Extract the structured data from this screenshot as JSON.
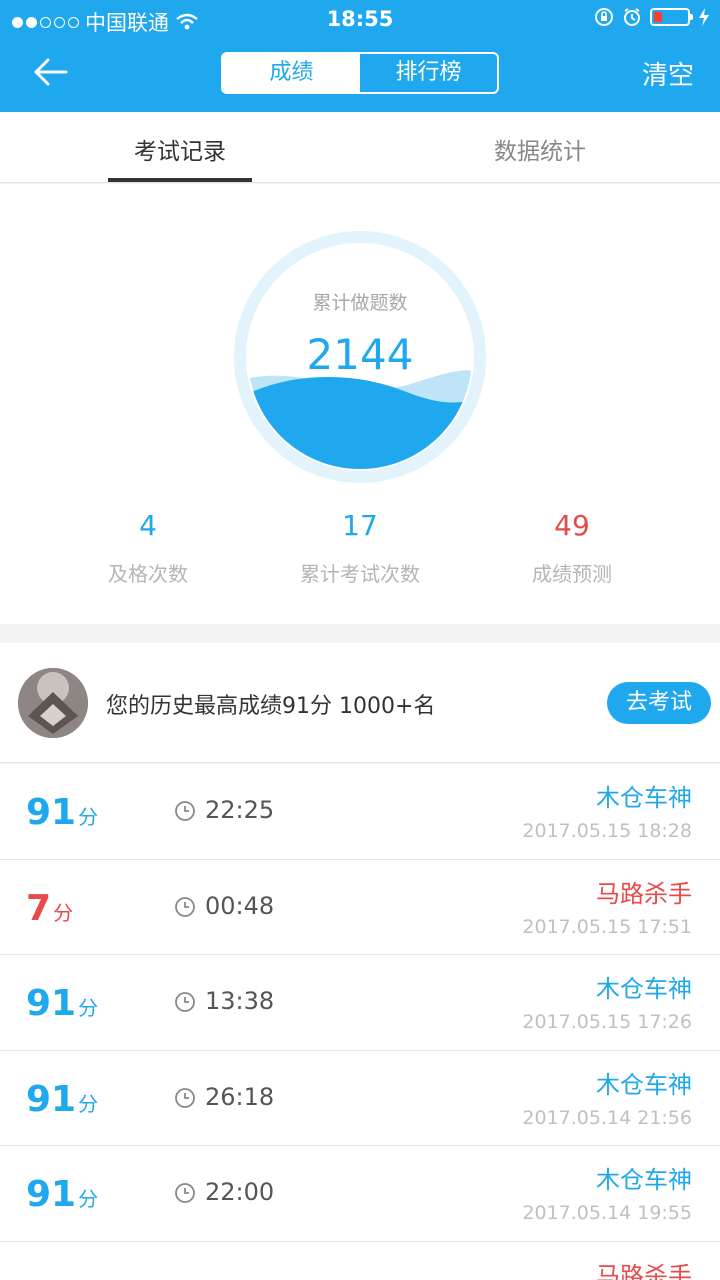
{
  "status_bar": {
    "carrier": "中国联通",
    "time": "18:55"
  },
  "header": {
    "segments": [
      "成绩",
      "排行榜"
    ],
    "active_segment": "成绩",
    "clear_label": "清空"
  },
  "tabs": [
    {
      "label": "考试记录",
      "active": true
    },
    {
      "label": "数据统计",
      "active": false
    }
  ],
  "summary": {
    "total_label": "累计做题数",
    "total_value": "2144",
    "stats": [
      {
        "value": "4",
        "label": "及格次数",
        "color": "#1fa8ee"
      },
      {
        "value": "17",
        "label": "累计考试次数",
        "color": "#1fa8ee"
      },
      {
        "value": "49",
        "label": "成绩预测",
        "color": "#e84a4a"
      }
    ]
  },
  "best": {
    "text": "您的历史最高成绩91分 1000+名",
    "button_label": "去考试"
  },
  "records": [
    {
      "score": "91",
      "unit": "分",
      "duration": "22:25",
      "title": "木仓车神",
      "date": "2017.05.15 18:28",
      "status": "pass"
    },
    {
      "score": "7",
      "unit": "分",
      "duration": "00:48",
      "title": "马路杀手",
      "date": "2017.05.15 17:51",
      "status": "fail"
    },
    {
      "score": "91",
      "unit": "分",
      "duration": "13:38",
      "title": "木仓车神",
      "date": "2017.05.15 17:26",
      "status": "pass"
    },
    {
      "score": "91",
      "unit": "分",
      "duration": "26:18",
      "title": "木仓车神",
      "date": "2017.05.14 21:56",
      "status": "pass"
    },
    {
      "score": "91",
      "unit": "分",
      "duration": "22:00",
      "title": "木仓车神",
      "date": "2017.05.14 19:55",
      "status": "pass"
    },
    {
      "score": "",
      "unit": "",
      "duration": "",
      "title": "马路杀手",
      "date": "",
      "status": "fail"
    }
  ],
  "colors": {
    "accent": "#1fa8ee",
    "danger": "#e84a4a"
  }
}
